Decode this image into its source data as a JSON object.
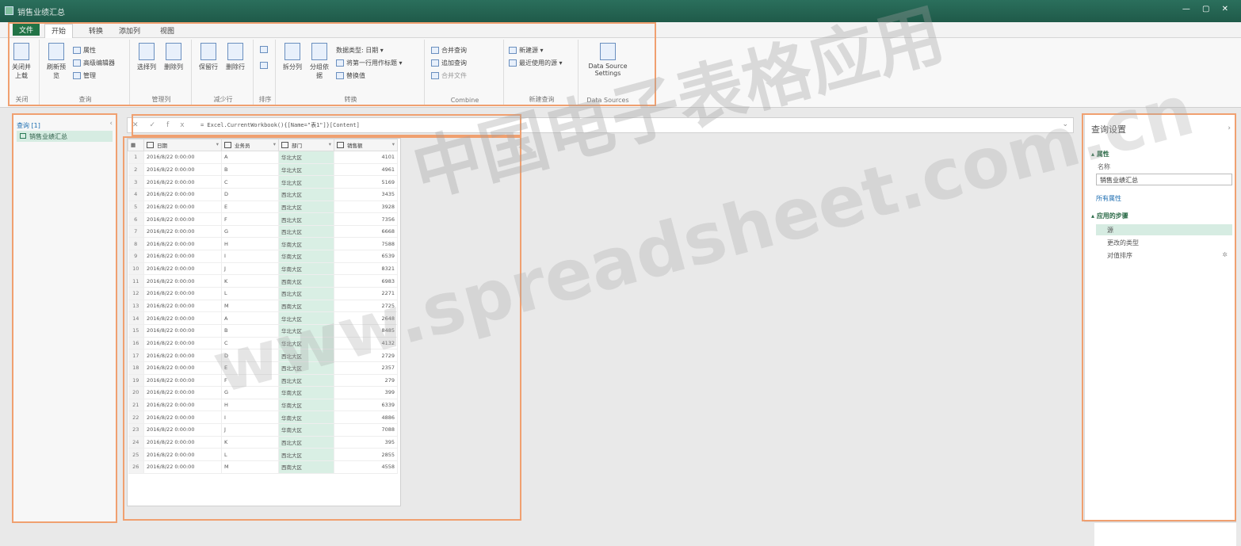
{
  "tabs": {
    "file": "文件",
    "home": "开始",
    "transform": "转换",
    "add_column": "添加列",
    "view": "视图"
  },
  "ribbon": {
    "close_apply": "关闭并上载",
    "refresh_preview": "刷新预览",
    "properties": "属性",
    "advanced_editor": "高级编辑器",
    "manage": "管理",
    "choose_columns": "选择列",
    "remove_columns": "删除列",
    "keep_rows": "保留行",
    "remove_rows": "删除行",
    "split_column": "拆分列",
    "group_by": "分组依据",
    "data_type": "数据类型: 日期",
    "use_first_row": "将第一行用作标题",
    "replace_values": "替换值",
    "merge_queries": "合并查询",
    "append_queries": "追加查询",
    "combine_files": "合并文件",
    "new_source": "新建源",
    "recent_sources": "最近使用的源",
    "data_source_settings": "Data Source Settings",
    "groups": {
      "close": "关闭",
      "query": "查询",
      "manage_columns": "管理列",
      "reduce_rows": "减少行",
      "sort": "排序",
      "transform": "转换",
      "combine": "Combine",
      "new_query": "新建查询",
      "data_sources": "Data Sources"
    }
  },
  "queries": {
    "header": "查询 [1]",
    "item": "销售业绩汇总"
  },
  "formula": {
    "text": "= Excel.CurrentWorkbook(){[Name=\"表1\"]}[Content]"
  },
  "columns": [
    "日期",
    "业务员",
    "部门",
    "销售额"
  ],
  "rows": [
    [
      "1",
      "2016/8/22 0:00:00",
      "A",
      "华北大区",
      "4101"
    ],
    [
      "2",
      "2016/8/22 0:00:00",
      "B",
      "华北大区",
      "4961"
    ],
    [
      "3",
      "2016/8/22 0:00:00",
      "C",
      "华北大区",
      "5169"
    ],
    [
      "4",
      "2016/8/22 0:00:00",
      "D",
      "西北大区",
      "3435"
    ],
    [
      "5",
      "2016/8/22 0:00:00",
      "E",
      "西北大区",
      "3928"
    ],
    [
      "6",
      "2016/8/22 0:00:00",
      "F",
      "西北大区",
      "7356"
    ],
    [
      "7",
      "2016/8/22 0:00:00",
      "G",
      "西北大区",
      "6668"
    ],
    [
      "8",
      "2016/8/22 0:00:00",
      "H",
      "华南大区",
      "7588"
    ],
    [
      "9",
      "2016/8/22 0:00:00",
      "I",
      "华南大区",
      "6539"
    ],
    [
      "10",
      "2016/8/22 0:00:00",
      "J",
      "华南大区",
      "8321"
    ],
    [
      "11",
      "2016/8/22 0:00:00",
      "K",
      "西南大区",
      "6983"
    ],
    [
      "12",
      "2016/8/22 0:00:00",
      "L",
      "西北大区",
      "2271"
    ],
    [
      "13",
      "2016/8/22 0:00:00",
      "M",
      "西南大区",
      "2725"
    ],
    [
      "14",
      "2016/8/22 0:00:00",
      "A",
      "华北大区",
      "2648"
    ],
    [
      "15",
      "2016/8/22 0:00:00",
      "B",
      "华北大区",
      "8485"
    ],
    [
      "16",
      "2016/8/22 0:00:00",
      "C",
      "华北大区",
      "4132"
    ],
    [
      "17",
      "2016/8/22 0:00:00",
      "D",
      "西北大区",
      "2729"
    ],
    [
      "18",
      "2016/8/22 0:00:00",
      "E",
      "西北大区",
      "2357"
    ],
    [
      "19",
      "2016/8/22 0:00:00",
      "F",
      "西北大区",
      "279"
    ],
    [
      "20",
      "2016/8/22 0:00:00",
      "G",
      "华南大区",
      "399"
    ],
    [
      "21",
      "2016/8/22 0:00:00",
      "H",
      "华南大区",
      "6339"
    ],
    [
      "22",
      "2016/8/22 0:00:00",
      "I",
      "华南大区",
      "4886"
    ],
    [
      "23",
      "2016/8/22 0:00:00",
      "J",
      "华南大区",
      "7088"
    ],
    [
      "24",
      "2016/8/22 0:00:00",
      "K",
      "西北大区",
      "395"
    ],
    [
      "25",
      "2016/8/22 0:00:00",
      "L",
      "西北大区",
      "2855"
    ],
    [
      "26",
      "2016/8/22 0:00:00",
      "M",
      "西南大区",
      "4558"
    ]
  ],
  "settings": {
    "title": "查询设置",
    "properties": "属性",
    "name_label": "名称",
    "name_value": "销售业绩汇总",
    "all_properties": "所有属性",
    "applied_steps": "应用的步骤",
    "steps": [
      "源",
      "更改的类型",
      "对值排序"
    ]
  },
  "watermark": {
    "line1": "中国电子表格应用",
    "line2": "www.spreadsheet.com.cn"
  },
  "colors": {
    "accent": "#217346",
    "highlight": "#f0a070",
    "selected": "#d6ece2"
  }
}
